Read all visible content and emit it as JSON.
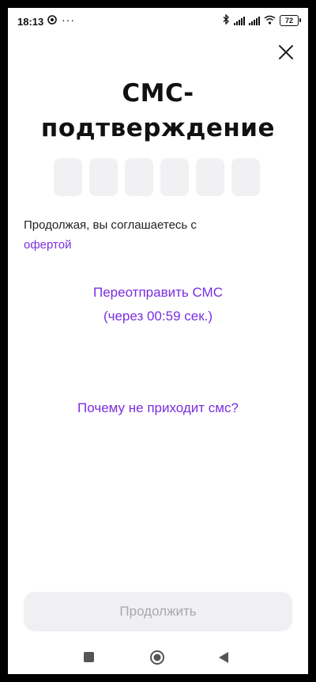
{
  "status_bar": {
    "time": "18:13",
    "dots": "···",
    "battery": "72"
  },
  "header": {
    "title_line1": "СМС-",
    "title_line2": "подтверждение"
  },
  "code_input": {
    "cells": [
      "",
      "",
      "",
      "",
      "",
      ""
    ]
  },
  "agreement": {
    "text": "Продолжая, вы соглашаетесь с",
    "link": "офертой"
  },
  "resend": {
    "line1": "Переотправить СМС",
    "line2": "(через 00:59 сек.)"
  },
  "help_link": "Почему не приходит смс?",
  "continue_label": "Продолжить",
  "colors": {
    "accent": "#7a2ee0",
    "button_bg": "#f0f0f2",
    "button_text": "#a9a9ad",
    "cell_bg": "#f1f1f4"
  },
  "icons": {
    "close": "close-icon",
    "nav_recent": "square-icon",
    "nav_home": "circle-icon",
    "nav_back": "triangle-back-icon"
  }
}
